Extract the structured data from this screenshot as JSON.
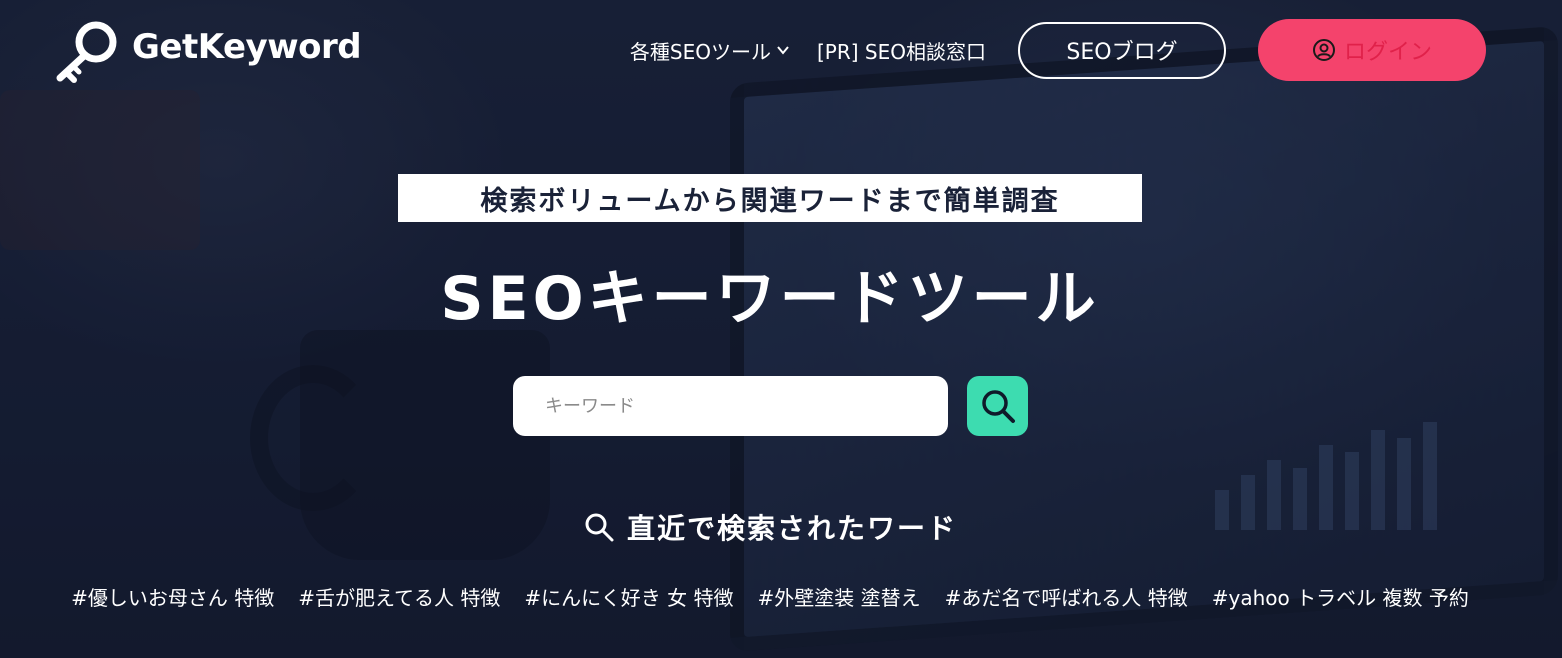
{
  "header": {
    "logo_text": "GetKeyword",
    "logo_icon": "key-magnifier-icon",
    "nav": {
      "seo_tools_label": "各種SEOツール",
      "consult_label": "[PR] SEO相談窓口",
      "blog_label": "SEOブログ",
      "login_label": "ログイン"
    }
  },
  "hero": {
    "tagline": "検索ボリュームから関連ワードまで簡単調査",
    "title": "SEOキーワードツール",
    "search": {
      "placeholder": "キーワード",
      "value": "",
      "button_icon": "search-icon"
    }
  },
  "recent": {
    "heading": "直近で検索されたワード",
    "tags": [
      "#優しいお母さん 特徴",
      "#舌が肥えてる人 特徴",
      "#にんにく好き 女 特徴",
      "#外壁塗装 塗替え",
      "#あだ名で呼ばれる人 特徴",
      "#yahoo トラベル 複数 予約"
    ]
  },
  "colors": {
    "background": "#1a2238",
    "login_button": "#f4436c",
    "search_button": "#3ddcb0",
    "tagline_bg": "#ffffff"
  }
}
